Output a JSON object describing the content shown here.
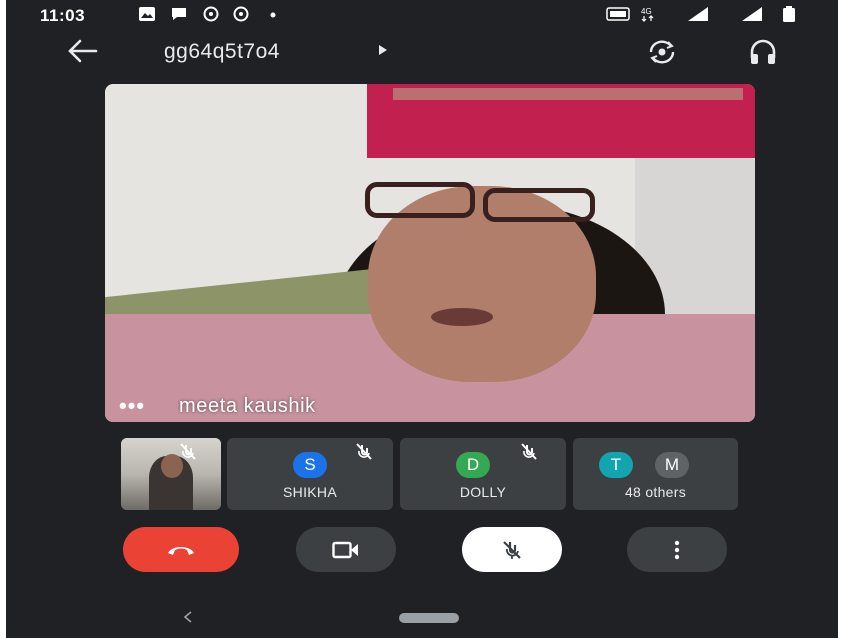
{
  "status_bar": {
    "time": "11:03",
    "icons": [
      "gallery-icon",
      "chat-bubble-icon",
      "whatsapp-icon",
      "whatsapp-icon",
      "dot-icon",
      "volte-icon",
      "4g-icon",
      "signal-icon",
      "signal-icon",
      "battery-icon"
    ]
  },
  "app_bar": {
    "meeting_code": "gg64q5t7o4",
    "icons": [
      "back-arrow-icon",
      "flip-camera-icon",
      "headphones-icon"
    ]
  },
  "main_video": {
    "participant_name": "meeta kaushik",
    "options_dots": "•••"
  },
  "participants": [
    {
      "kind": "self-video",
      "muted": true
    },
    {
      "initial": "S",
      "name": "SHIKHA",
      "color": "#1a73e8",
      "muted": true
    },
    {
      "initial": "D",
      "name": "DOLLY",
      "color": "#34a853",
      "muted": true
    },
    {
      "initials": [
        "T",
        "M"
      ],
      "colors": [
        "#12a4af",
        "#5f6368"
      ],
      "name": "48 others"
    }
  ],
  "controls": {
    "end_call_color": "#ea4335",
    "buttons": [
      "end-call",
      "toggle-video",
      "toggle-mic",
      "more-options"
    ]
  },
  "nav_bar": {
    "back_glyph": "<"
  }
}
